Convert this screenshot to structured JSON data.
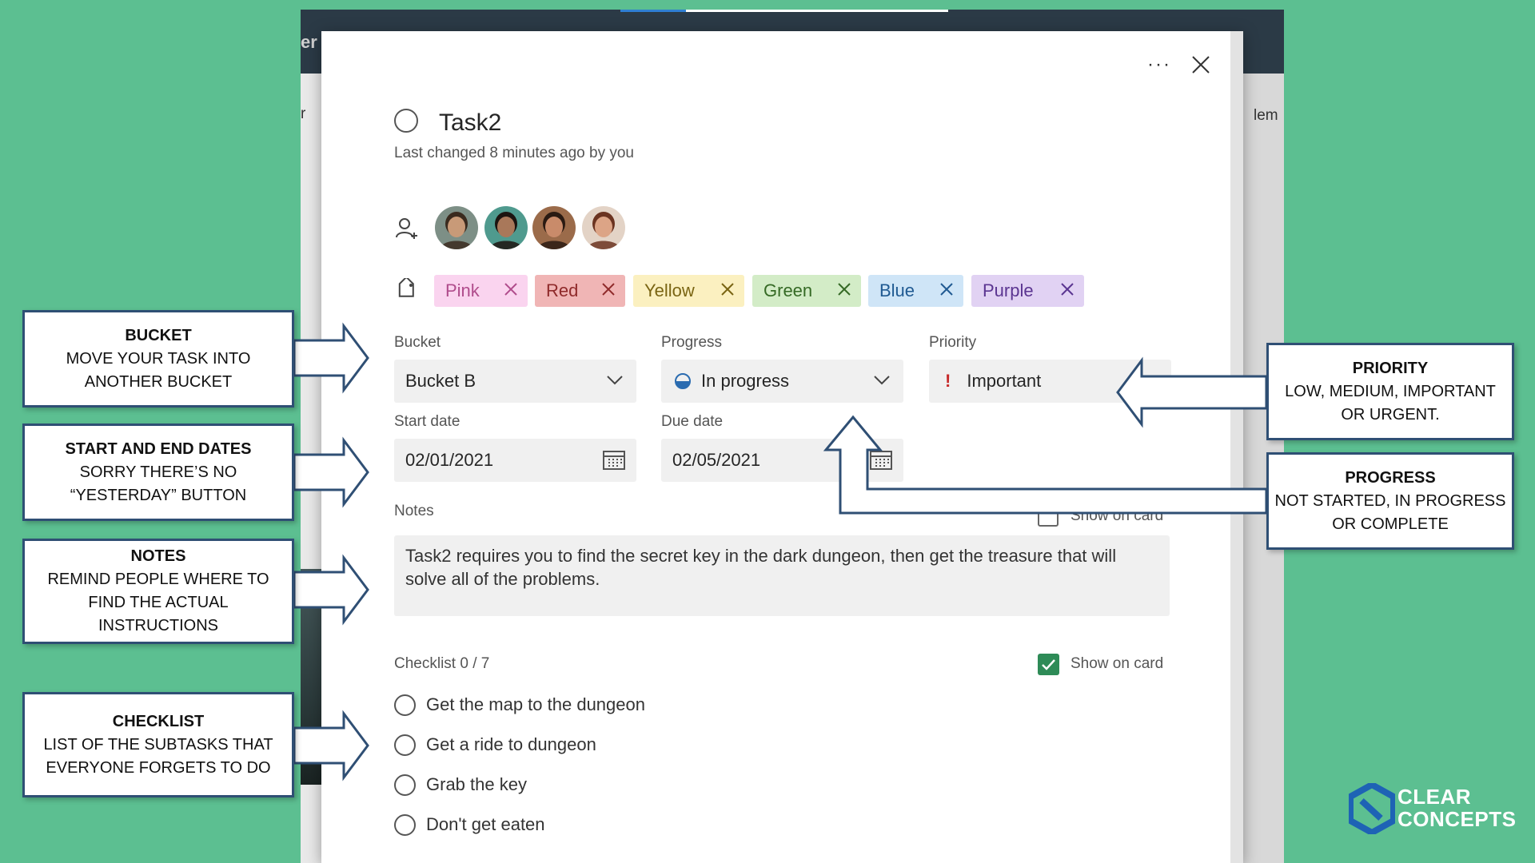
{
  "background_app": {
    "title_fragment": "er",
    "right_fragment": "lem",
    "left_fragment": "r"
  },
  "dialog": {
    "more_icon": "more-options-icon",
    "close_icon": "close-icon",
    "task": {
      "title": "Task2",
      "last_changed": "Last changed 8 minutes ago by you"
    },
    "assignees": {
      "icon": "add-person-icon",
      "avatars": [
        {
          "name": "avatar-1",
          "skin": "#c89a78",
          "hair": "#3a2a1e",
          "bg": "#7d8f86"
        },
        {
          "name": "avatar-2",
          "skin": "#a9785a",
          "hair": "#1c1410",
          "bg": "#4f9a8e"
        },
        {
          "name": "avatar-3",
          "skin": "#c98b6a",
          "hair": "#2a1a12",
          "bg": "#9b6b4a"
        },
        {
          "name": "avatar-4",
          "skin": "#dca486",
          "hair": "#6b3320",
          "bg": "#e3d3c6"
        }
      ]
    },
    "labels": [
      {
        "text": "Pink",
        "bg": "#fad4ef",
        "fg": "#b04c8c"
      },
      {
        "text": "Red",
        "bg": "#f0b5b5",
        "fg": "#8f2a2a"
      },
      {
        "text": "Yellow",
        "bg": "#fbf0c0",
        "fg": "#7a6513"
      },
      {
        "text": "Green",
        "bg": "#d3ecc7",
        "fg": "#356a25"
      },
      {
        "text": "Blue",
        "bg": "#cfe5f7",
        "fg": "#205a92"
      },
      {
        "text": "Purple",
        "bg": "#e1d2f3",
        "fg": "#5b3591"
      }
    ],
    "fields": {
      "bucket_label": "Bucket",
      "bucket_value": "Bucket B",
      "progress_label": "Progress",
      "progress_value": "In progress",
      "priority_label": "Priority",
      "priority_value": "Important",
      "priority_icon": "!",
      "start_label": "Start date",
      "start_value": "02/01/2021",
      "due_label": "Due date",
      "due_value": "02/05/2021"
    },
    "notes": {
      "label": "Notes",
      "show_on_card": "Show on card",
      "text": "Task2 requires you to find the secret key in the dark dungeon, then get the treasure that will solve all of the problems."
    },
    "checklist": {
      "title": "Checklist 0 / 7",
      "show_on_card": "Show on card",
      "items": [
        "Get the map to the dungeon",
        "Get a ride to dungeon",
        "Grab the key",
        "Don't get eaten"
      ]
    }
  },
  "callouts": {
    "bucket": {
      "title": "BUCKET",
      "lines": [
        "MOVE YOUR TASK INTO",
        "ANOTHER BUCKET"
      ]
    },
    "dates": {
      "title": "START AND END DATES",
      "lines": [
        "SORRY THERE’S NO",
        "“YESTERDAY” BUTTON"
      ]
    },
    "notes": {
      "title": "NOTES",
      "lines": [
        "REMIND PEOPLE WHERE TO",
        "FIND THE ACTUAL",
        "INSTRUCTIONS"
      ]
    },
    "checklist": {
      "title": "CHECKLIST",
      "lines": [
        "LIST OF THE SUBTASKS THAT",
        "EVERYONE FORGETS TO DO"
      ]
    },
    "priority": {
      "title": "PRIORITY",
      "lines": [
        "LOW, MEDIUM, IMPORTANT",
        "OR URGENT."
      ]
    },
    "progress": {
      "title": "PROGRESS",
      "lines": [
        "NOT STARTED, IN PROGRESS",
        "OR COMPLETE"
      ]
    }
  },
  "logo": {
    "line1": "CLEAR",
    "line2": "CONCEPTS"
  }
}
